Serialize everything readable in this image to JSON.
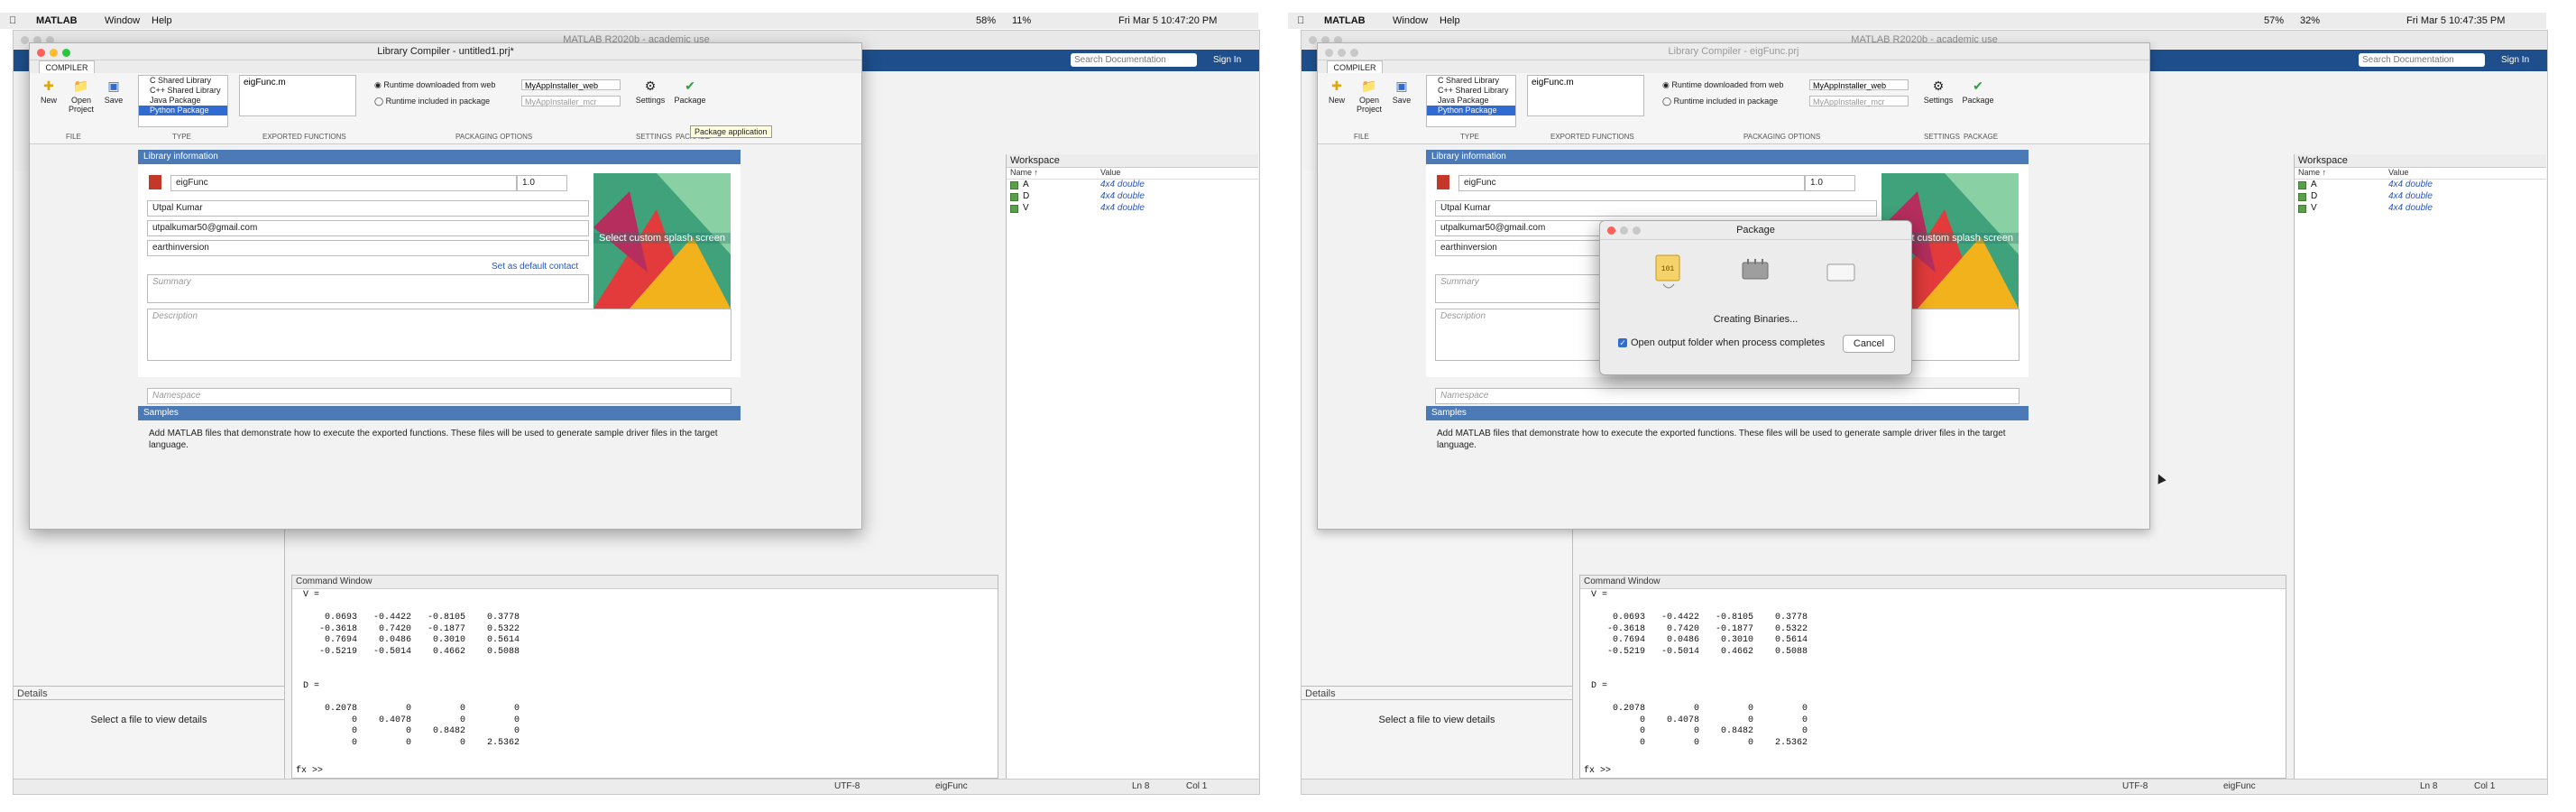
{
  "colors": {
    "ribbon_blue": "#1e4f8c",
    "section_blue": "#4c7ab7",
    "link_blue": "#2a57b8",
    "selection": "#2f6bd1",
    "workspace_icon": "#5a9f4a"
  },
  "common": {
    "menu": {
      "app": "MATLAB",
      "window": "Window",
      "help": "Help"
    },
    "window_title": "MATLAB R2020b - academic use",
    "search_placeholder": "Search Documentation",
    "sign_in": "Sign In",
    "ribbon": {
      "tab": "COMPILER",
      "new": "New",
      "open": "Open\nProject",
      "save": "Save",
      "file_label": "FILE",
      "type_label": "TYPE",
      "exported_label": "EXPORTED FUNCTIONS",
      "packaging_label": "PACKAGING OPTIONS",
      "settings_label": "SETTINGS",
      "package_label": "PACKAGE",
      "types": [
        "C Shared Library",
        "C++ Shared Library",
        "Java Package",
        "Python Package"
      ],
      "exported_file": "eigFunc.m",
      "runtime_web": "Runtime downloaded from web",
      "runtime_web_value": "MyAppInstaller_web",
      "runtime_pkg": "Runtime included in package",
      "runtime_pkg_value": "MyAppInstaller_mcr",
      "settings": "Settings",
      "package": "Package"
    },
    "library": {
      "section": "Library information",
      "name": "eigFunc",
      "version": "1.0",
      "author": "Utpal Kumar",
      "email": "utpalkumar50@gmail.com",
      "company": "earthinversion",
      "default_contact": "Set as default contact",
      "summary_placeholder": "Summary",
      "description_placeholder": "Description",
      "splash_label": "Select custom splash screen",
      "namespace_placeholder": "Namespace"
    },
    "samples": {
      "section": "Samples",
      "text": "Add MATLAB files that demonstrate how to execute the exported functions.  These files will be used to generate sample driver files in the target language."
    },
    "details": {
      "label": "Details",
      "empty": "Select a file to view details"
    },
    "command_window": {
      "title": "Command Window",
      "output": "V =\n\n    0.0693   -0.4422   -0.8105    0.3778\n   -0.3618    0.7420   -0.1877    0.5322\n    0.7694    0.0486    0.3010    0.5614\n   -0.5219   -0.5014    0.4662    0.5088\n\n\nD =\n\n    0.2078         0         0         0\n         0    0.4078         0         0\n         0         0    0.8482         0\n         0         0         0    2.5362",
      "prompt": "fx >>"
    },
    "workspace": {
      "title": "Workspace",
      "col_name": "Name ↑",
      "col_value": "Value",
      "vars": [
        {
          "name": "A",
          "value": "4x4 double"
        },
        {
          "name": "D",
          "value": "4x4 double"
        },
        {
          "name": "V",
          "value": "4x4 double"
        }
      ]
    },
    "status": {
      "encoding": "UTF-8",
      "function": "eigFunc",
      "ln": "Ln  8",
      "col": "Col  1"
    }
  },
  "left_panel": {
    "clock": "Fri Mar 5  10:47:20 PM",
    "battery": "58%",
    "cpu": "11%",
    "compiler_title": "Library Compiler - untitled1.prj*",
    "tooltip": "Package application"
  },
  "right_panel": {
    "clock": "Fri Mar 5  10:47:35 PM",
    "battery": "57%",
    "cpu": "32%",
    "compiler_title": "Library Compiler - eigFunc.prj",
    "dialog": {
      "title": "Package",
      "status": "Creating Binaries...",
      "open_output": "Open output folder when process completes",
      "cancel": "Cancel"
    }
  }
}
